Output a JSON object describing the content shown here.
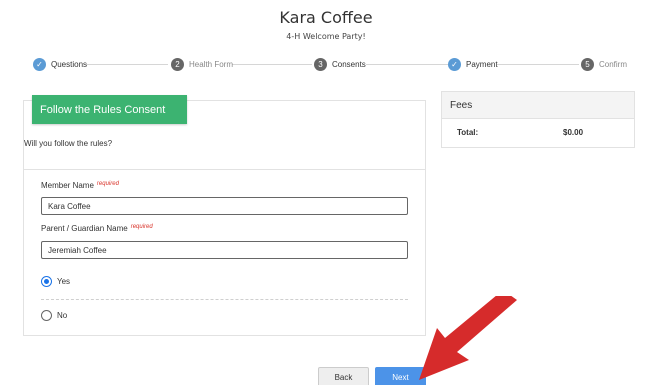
{
  "header": {
    "title": "Kara Coffee",
    "subtitle": "4-H Welcome Party!"
  },
  "steps": [
    {
      "label": "Questions",
      "status": "done",
      "icon": "check-icon"
    },
    {
      "label": "Health Form",
      "status": "pending",
      "number": "2"
    },
    {
      "label": "Consents",
      "status": "pending",
      "number": "3"
    },
    {
      "label": "Payment",
      "status": "done",
      "icon": "check-icon"
    },
    {
      "label": "Confirm",
      "status": "pending",
      "number": "5"
    }
  ],
  "consent": {
    "banner_title": "Follow the Rules Consent",
    "question": "Will you follow the rules?",
    "member_name_label": "Member Name",
    "member_name_value": "Kara Coffee",
    "guardian_name_label": "Parent / Guardian Name",
    "guardian_name_value": "Jeremiah Coffee",
    "required_tag": "required",
    "options": [
      {
        "label": "Yes",
        "checked": true
      },
      {
        "label": "No",
        "checked": false
      }
    ]
  },
  "fees": {
    "title": "Fees",
    "total_label": "Total:",
    "total_value": "$0.00"
  },
  "buttons": {
    "back": "Back",
    "next": "Next"
  },
  "colors": {
    "accent": "#5b9bd5",
    "banner": "#3cb371",
    "next_button": "#4c93e8",
    "arrow": "#d62b2b"
  }
}
